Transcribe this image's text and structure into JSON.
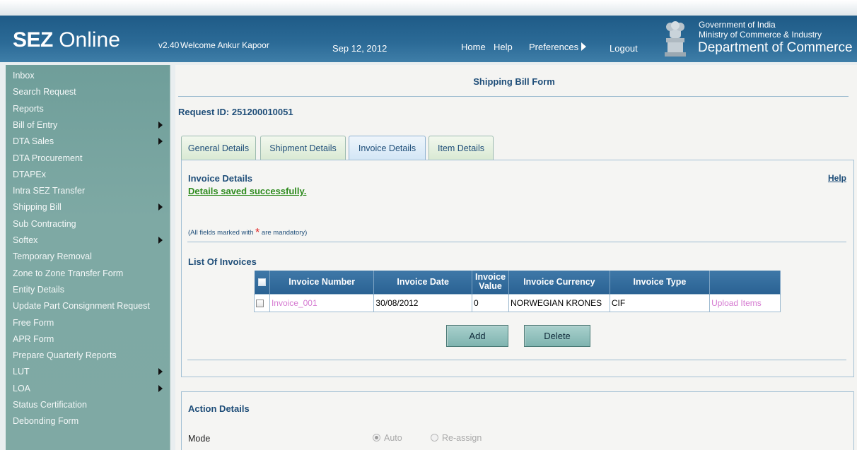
{
  "header": {
    "logo_bold": "SEZ",
    "logo_rest": " Online",
    "version": "v2.40",
    "welcome": "Welcome Ankur Kapoor",
    "date": "Sep 12, 2012",
    "nav": {
      "home": "Home",
      "help": "Help",
      "preferences": "Preferences",
      "logout": "Logout"
    },
    "gov_line1": "Government of India",
    "gov_line2": "Ministry of Commerce & Industry",
    "dept": "Department of Commerce"
  },
  "sidebar": {
    "items": [
      {
        "label": "Inbox",
        "arrow": false
      },
      {
        "label": "Search Request",
        "arrow": false
      },
      {
        "label": "Reports",
        "arrow": false
      },
      {
        "label": "Bill of Entry",
        "arrow": true
      },
      {
        "label": "DTA Sales",
        "arrow": true
      },
      {
        "label": "DTA Procurement",
        "arrow": false
      },
      {
        "label": "DTAPEx",
        "arrow": false
      },
      {
        "label": "Intra SEZ Transfer",
        "arrow": false
      },
      {
        "label": "Shipping Bill",
        "arrow": true
      },
      {
        "label": "Sub Contracting",
        "arrow": false
      },
      {
        "label": "Softex",
        "arrow": true
      },
      {
        "label": "Temporary Removal",
        "arrow": false
      },
      {
        "label": "Zone to Zone Transfer Form",
        "arrow": false
      },
      {
        "label": "Entity Details",
        "arrow": false
      },
      {
        "label": "Update Part Consignment Request",
        "arrow": false
      },
      {
        "label": "Free Form",
        "arrow": false
      },
      {
        "label": "APR Form",
        "arrow": false
      },
      {
        "label": "Prepare Quarterly Reports",
        "arrow": false
      },
      {
        "label": "LUT",
        "arrow": true
      },
      {
        "label": "LOA",
        "arrow": true
      },
      {
        "label": "Status Certification",
        "arrow": false
      },
      {
        "label": "Debonding Form",
        "arrow": false
      }
    ]
  },
  "main": {
    "form_title": "Shipping Bill Form",
    "request_id": "Request ID: 251200010051",
    "tabs": [
      {
        "label": "General Details"
      },
      {
        "label": "Shipment Details"
      },
      {
        "label": "Invoice Details"
      },
      {
        "label": "Item Details"
      }
    ],
    "invoice": {
      "title": "Invoice Details",
      "help": "Help",
      "saved_msg": "Details saved successfully.",
      "mandatory_pre": "(All fields marked with ",
      "mandatory_star": "*",
      "mandatory_post": " are mandatory)",
      "list_title": "List Of Invoices",
      "columns": [
        "Invoice Number",
        "Invoice Date",
        "Invoice Value",
        "Invoice Currency",
        "Invoice Type",
        ""
      ],
      "rows": [
        {
          "number": "Invoice_001",
          "date": "30/08/2012",
          "value": "0",
          "currency": "NORWEGIAN KRONES",
          "type": "CIF",
          "action": "Upload Items"
        }
      ],
      "add_label": "Add",
      "delete_label": "Delete"
    },
    "action": {
      "title": "Action Details",
      "mode_label": "Mode",
      "options": [
        {
          "label": "Auto",
          "selected": true
        },
        {
          "label": "Re-assign",
          "selected": false
        }
      ]
    }
  },
  "colors": {
    "header_blue": "#2b6a96",
    "sidebar_teal": "#7ea9a4",
    "title_blue": "#1f4e79",
    "success_green": "#2e8b1e",
    "link_pink": "#d57ad1"
  }
}
